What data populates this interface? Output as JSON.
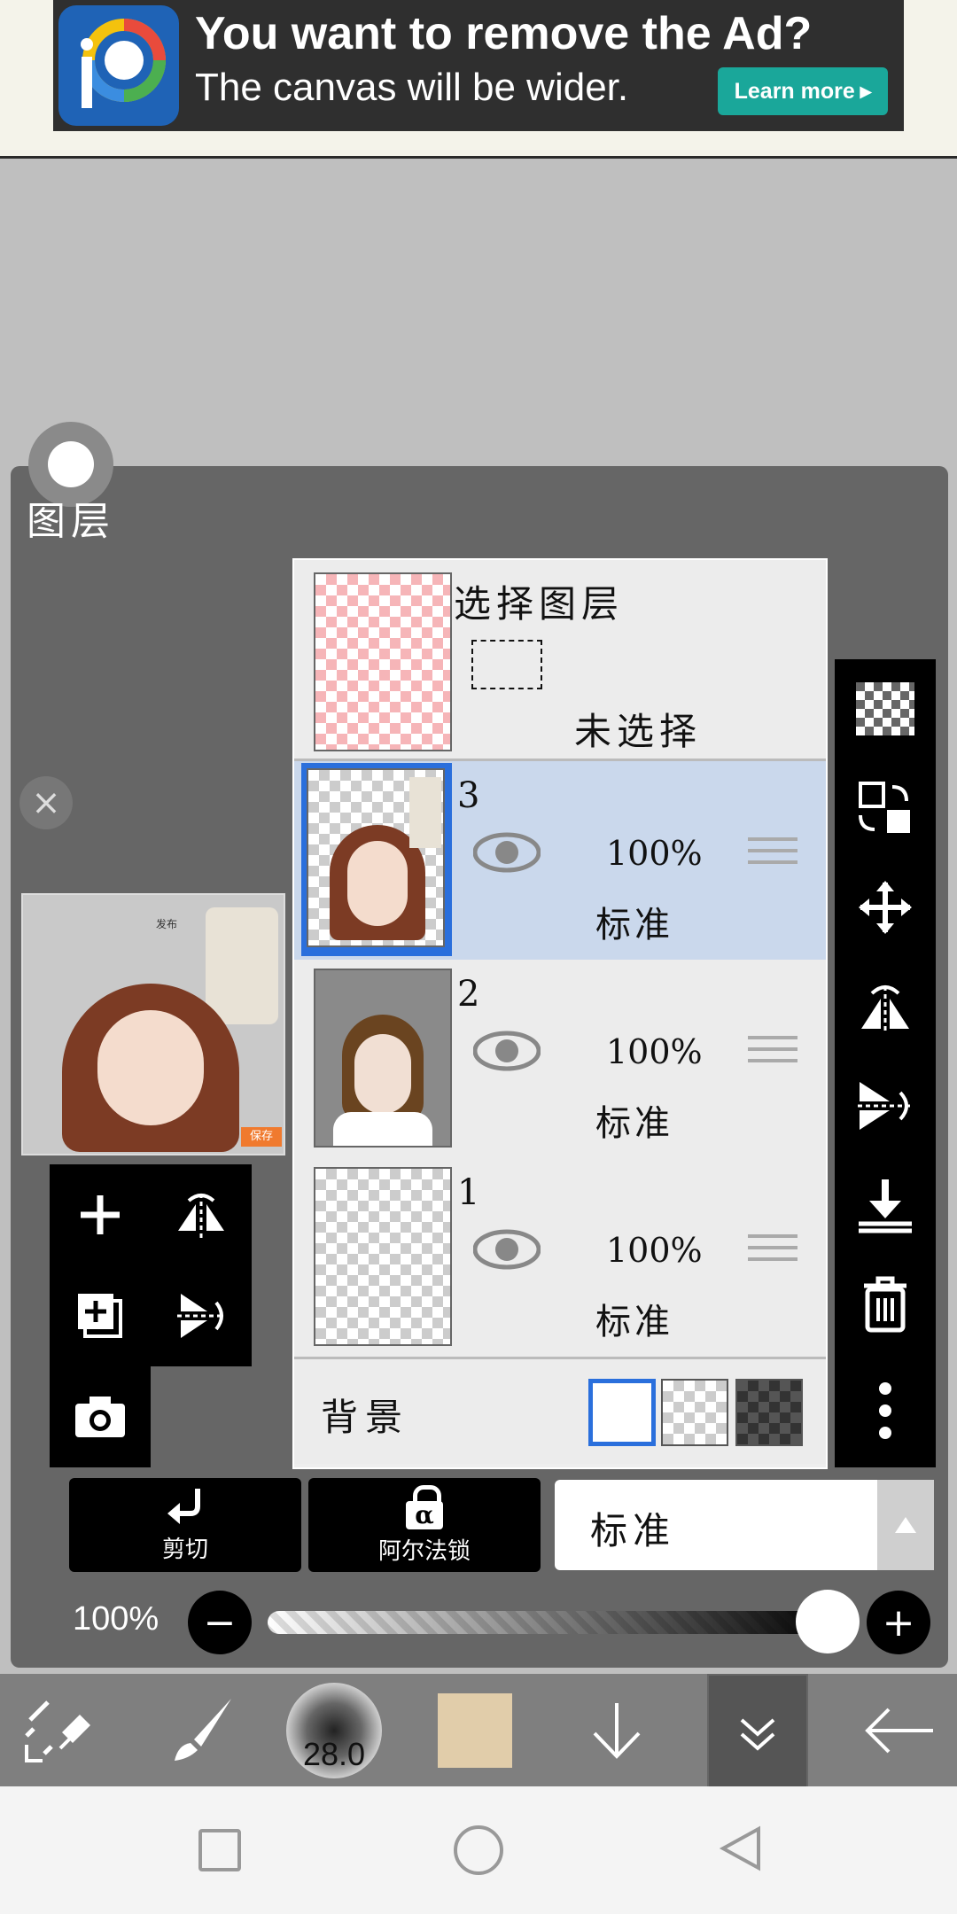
{
  "ad": {
    "headline": "You want to remove the Ad?",
    "subline": "The canvas will be wider.",
    "learn_more": "Learn more",
    "learn_more_icon": "play-triangle-icon"
  },
  "panel": {
    "title": "图层"
  },
  "layers": {
    "selection": {
      "title": "选择图层",
      "status": "未选择"
    },
    "items": [
      {
        "number": "3",
        "opacity": "100%",
        "mode": "标准",
        "selected": true
      },
      {
        "number": "2",
        "opacity": "100%",
        "mode": "标准",
        "selected": false
      },
      {
        "number": "1",
        "opacity": "100%",
        "mode": "标准",
        "selected": false
      }
    ],
    "background": {
      "label": "背景"
    }
  },
  "preview": {
    "save_label": "保存",
    "post_label": "发布"
  },
  "buttons": {
    "clipping": "剪切",
    "alpha_lock": "阿尔法锁",
    "alpha_symbol": "α"
  },
  "blend": {
    "mode": "标准"
  },
  "opacity": {
    "label": "100%",
    "value": 1.0
  },
  "toolbar": {
    "brush_size": "28.0",
    "color": "#e1cdaa"
  },
  "colors": {
    "selected_layer_bg": "#cad8ec",
    "selected_border": "#2a6fdc",
    "panel_bg": "#666666"
  }
}
